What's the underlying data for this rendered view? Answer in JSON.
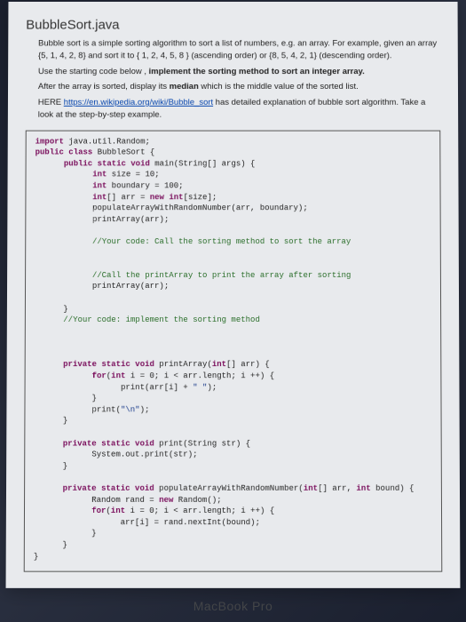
{
  "title": "BubbleSort.java",
  "instructions": {
    "p1a": "Bubble sort is a simple sorting algorithm to sort a list of numbers, e.g. an array. For example, given an array {5, 1, 4, 2, 8} and sort it to { 1, 2, 4, 5, 8 } (ascending order) or {8, 5, 4, 2, 1} (descending order).",
    "p2a": "Use the starting code below , ",
    "p2b": "implement the sorting method to sort an integer array.",
    "p3a": "After the array is sorted, display its ",
    "p3b": "median",
    "p3c": " which is the middle value of the sorted list.",
    "p4a": "HERE ",
    "p4link": "https://en.wikipedia.org/wiki/Bubble_sort",
    "p4b": " has detailed explanation of bubble sort algorithm. Take a look at the step-by-step example."
  },
  "code": {
    "l1a": "import",
    "l1b": " java.util.Random;",
    "l2a": "public class",
    "l2b": " BubbleSort {",
    "l3a": "public static void",
    "l3b": " main(String[] args) {",
    "l4a": "int",
    "l4b": " size = 10;",
    "l5a": "int",
    "l5b": " boundary = 100;",
    "l6a": "int",
    "l6b": "[] arr = ",
    "l6c": "new int",
    "l6d": "[size];",
    "l7": "populateArrayWithRandomNumber(arr, boundary);",
    "l8": "printArray(arr);",
    "c1": "//Your code: Call the sorting method to sort the array",
    "c2": "//Call the printArray to print the array after sorting",
    "l9": "printArray(arr);",
    "l10": "}",
    "c3": "//Your code: implement the sorting method",
    "l11a": "private static void",
    "l11b": " printArray(",
    "l11c": "int",
    "l11d": "[] arr) {",
    "l12a": "for",
    "l12b": "(",
    "l12c": "int",
    "l12d": " i = 0; i < arr.length; i ++) {",
    "l13a": "print(arr[i] + ",
    "l13b": "\" \"",
    "l13c": ");",
    "l14": "}",
    "l15a": "print(",
    "l15b": "\"\\n\"",
    "l15c": ");",
    "l16": "}",
    "l17a": "private static void",
    "l17b": " print(String str) {",
    "l18": "System.out.print(str);",
    "l19": "}",
    "l20a": "private static void",
    "l20b": " populateArrayWithRandomNumber(",
    "l20c": "int",
    "l20d": "[] arr, ",
    "l20e": "int",
    "l20f": " bound) {",
    "l21a": "Random rand = ",
    "l21b": "new",
    "l21c": " Random();",
    "l22a": "for",
    "l22b": "(",
    "l22c": "int",
    "l22d": " i = 0; i < arr.length; i ++) {",
    "l23": "arr[i] = rand.nextInt(bound);",
    "l24": "}",
    "l25": "}",
    "l26": "}"
  },
  "device": "MacBook Pro"
}
